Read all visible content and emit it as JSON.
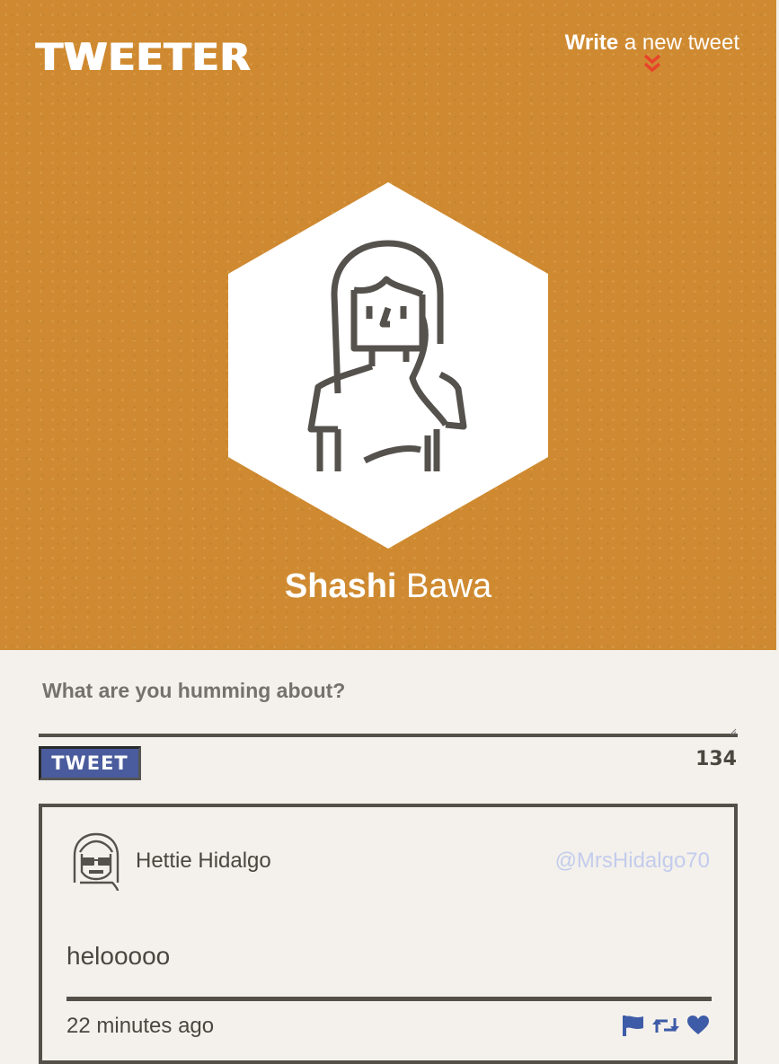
{
  "nav": {
    "logo": "TWEETER",
    "compose_bold": "Write",
    "compose_rest": " a new tweet",
    "compose_icon": "double-chevron-down-icon",
    "accent_color": "#e8442b"
  },
  "profile": {
    "first_name": "Shashi",
    "last_name": " Bawa",
    "avatar_icon": "woman-avatar-icon",
    "header_color": "#cf8a31"
  },
  "composer": {
    "label": "What are you humming about?",
    "value": "",
    "button_label": "TWEET",
    "counter": "134",
    "button_color": "#4a5c9d"
  },
  "tweets": [
    {
      "author": "Hettie Hidalgo",
      "handle": "@MrsHidalgo70",
      "text": "helooooo",
      "time": "22 minutes ago",
      "avatar_icon": "woman-sunglasses-avatar-icon",
      "actions": [
        "flag-icon",
        "retweet-icon",
        "heart-icon"
      ],
      "action_color": "#3e5ba8"
    }
  ]
}
